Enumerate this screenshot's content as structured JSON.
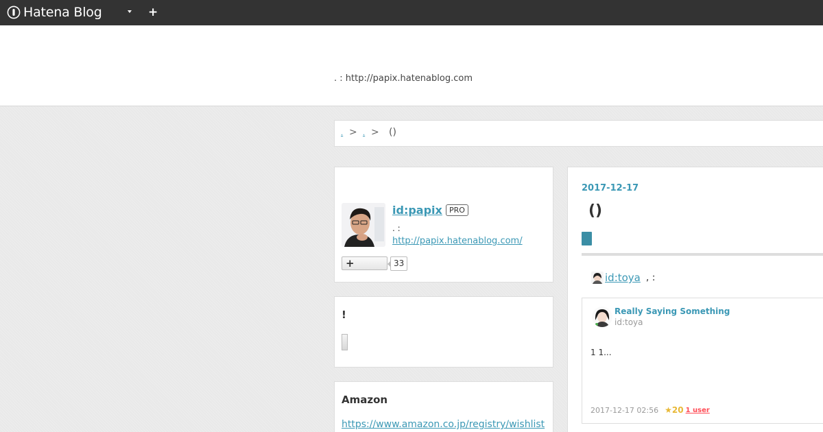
{
  "header": {
    "brand": "Hatena Blog",
    "plus_label": "+"
  },
  "blog": {
    "description": ". : http://papix.hatenablog.com"
  },
  "breadcrumb": {
    "items": [
      ".",
      "."
    ],
    "separator": ">",
    "current": "()"
  },
  "profile": {
    "id_label": "id:papix",
    "badge": "PRO",
    "description": ". :",
    "url": "http://papix.hatenablog.com/",
    "follow_icon": "+",
    "follower_count": "33"
  },
  "search": {
    "title": "!"
  },
  "amazon": {
    "title": "Amazon",
    "link": "https://www.amazon.co.jp/registry/wishlist"
  },
  "entry": {
    "date": "2017-12-17",
    "title": "()",
    "author_id": "id:toya",
    "author_suffix": ", :",
    "embed": {
      "title": "Really Saying Something",
      "subtitle": "id:toya",
      "excerpt": "1 1...",
      "timestamp": "2017-12-17 02:56",
      "star_icon": "★",
      "star_count": "20",
      "users": "1 user"
    }
  },
  "colors": {
    "link": "#3b98b5",
    "header_bg": "#333333",
    "category": "#3b8ea5",
    "star": "#e8b836",
    "bookmark": "#ff4b55"
  }
}
